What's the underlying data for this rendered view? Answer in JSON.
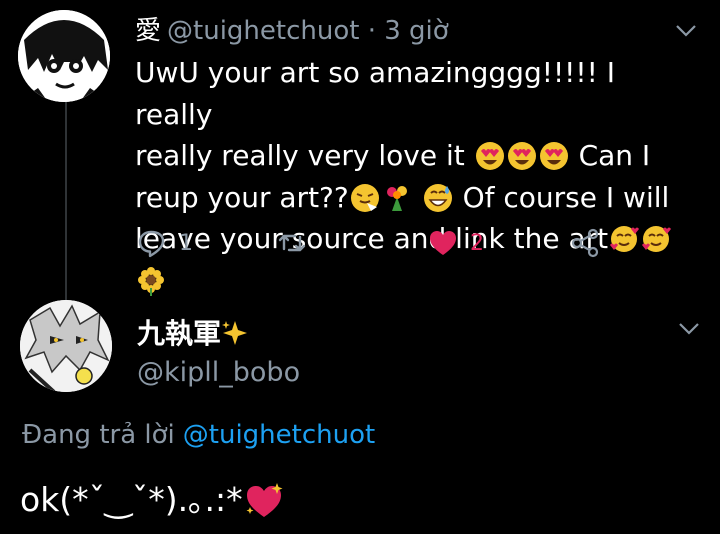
{
  "tweet": {
    "name": "愛",
    "handle": "@tuighetchuot",
    "time": "· 3 giờ",
    "lines": [
      "UwU your art so amazingggg!!!!! I really",
      "really really very love it",
      "Can I",
      "reup your art??",
      "Of course I will",
      "leave your source and link the art"
    ],
    "reply_count": "1",
    "like_count": "2"
  },
  "reply": {
    "name": "九執軍",
    "handle": "@kipll_bobo",
    "replying_label": "Đang trả lời",
    "replying_to": "@tuighetchuot",
    "text": "ok(*ˇ‿ˇ*).｡.:*"
  },
  "colors": {
    "background": "#000000",
    "secondary_text": "#8b98a5",
    "like": "#e0245e",
    "link": "#1da1f2"
  }
}
